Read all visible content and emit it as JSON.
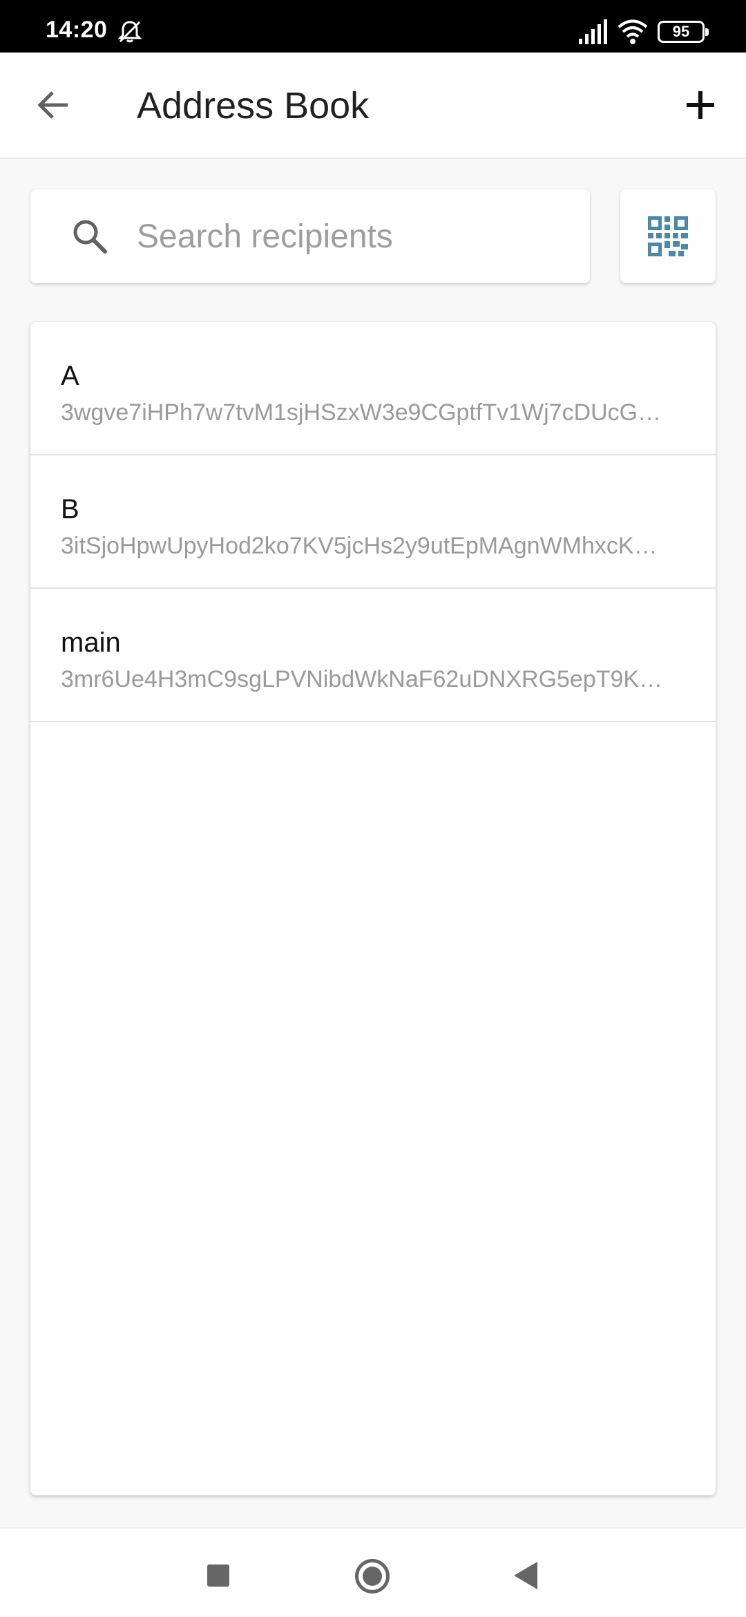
{
  "status_bar": {
    "time": "14:20",
    "battery_level": "95",
    "icons": [
      "mute-icon",
      "cell-signal-icon",
      "wifi-icon",
      "battery-icon"
    ]
  },
  "app_bar": {
    "title": "Address Book",
    "back_icon": "arrow-left-icon",
    "add_icon": "plus-icon"
  },
  "search": {
    "placeholder": "Search recipients",
    "value": "",
    "icon": "search-icon",
    "qr_icon": "qr-code-icon"
  },
  "recipients": [
    {
      "name": "A",
      "address": "3wgve7iHPh7w7tvM1sjHSzxW3e9CGptfTv1Wj7cDUcG…"
    },
    {
      "name": "B",
      "address": "3itSjoHpwUpyHod2ko7KV5jcHs2y9utEpMAgnWMhxcK…"
    },
    {
      "name": "main",
      "address": "3mr6Ue4H3mC9sgLPVNibdWkNaF62uDNXRG5epT9K…"
    }
  ],
  "colors": {
    "accent": "#4a89a8",
    "text_primary": "#212121",
    "text_secondary": "#9a9a9a",
    "background": "#f8f8f8"
  },
  "nav_bar": {
    "icons": [
      "recents-icon",
      "home-icon",
      "back-triangle-icon"
    ]
  }
}
